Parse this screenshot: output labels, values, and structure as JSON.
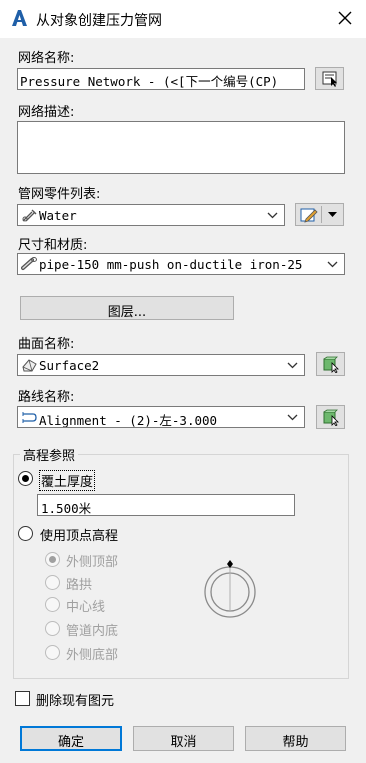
{
  "window": {
    "title": "从对象创建压力管网"
  },
  "network_name": {
    "label": "网络名称:",
    "value": "Pressure Network - (<[下一个编号(CP)"
  },
  "network_description": {
    "label": "网络描述:",
    "value": ""
  },
  "parts_list": {
    "label": "管网零件列表:",
    "value": "Water"
  },
  "size_material": {
    "label": "尺寸和材质:",
    "value": "pipe-150 mm-push on-ductile iron-25"
  },
  "layers_button": "图层...",
  "surface": {
    "label": "曲面名称:",
    "value": "Surface2"
  },
  "alignment": {
    "label": "路线名称:",
    "value": "Alignment - (2)-左-3.000"
  },
  "elevation": {
    "group_label": "高程参照",
    "cover_depth": {
      "label": "覆土厚度",
      "selected": true,
      "value": "1.500米"
    },
    "use_vertex": {
      "label": "使用顶点高程",
      "selected": false
    },
    "reference_options": [
      "外侧顶部",
      "路拱",
      "中心线",
      "管道内底",
      "外侧底部"
    ],
    "reference_selected_index": 0
  },
  "delete_existing": {
    "label": "删除现有图元",
    "checked": false
  },
  "buttons": {
    "ok": "确定",
    "cancel": "取消",
    "help": "帮助"
  }
}
